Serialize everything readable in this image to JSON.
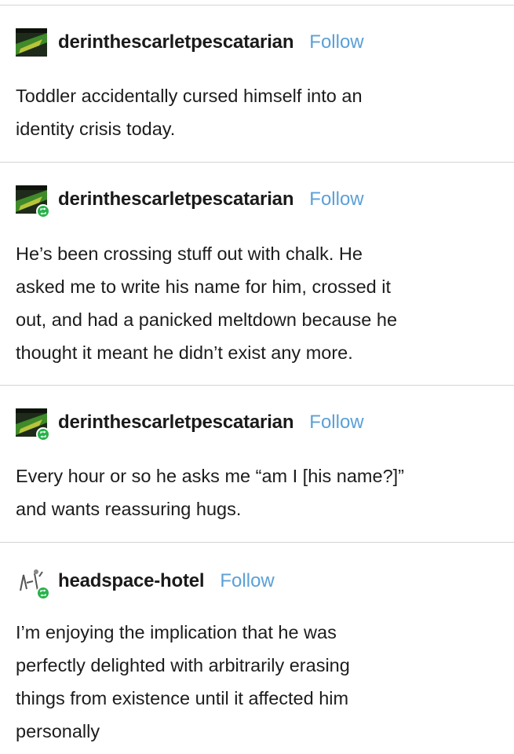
{
  "posts": [
    {
      "username": "derinthescarletpescatarian",
      "follow_label": "Follow",
      "avatar_icon": "green-abstract-avatar-icon",
      "lines": [
        "Toddler accidentally cursed himself into an",
        "identity crisis today."
      ]
    },
    {
      "username": "derinthescarletpescatarian",
      "follow_label": "Follow",
      "avatar_icon": "green-abstract-avatar-icon",
      "badge_icon": "reblog-badge-icon",
      "lines": [
        "He’s been crossing stuff out with chalk. He",
        "asked me to write his name for him, crossed it",
        "out, and had a panicked meltdown because he",
        "thought it meant he didn’t exist any more."
      ]
    },
    {
      "username": "derinthescarletpescatarian",
      "follow_label": "Follow",
      "avatar_icon": "green-abstract-avatar-icon",
      "badge_icon": "reblog-badge-icon",
      "lines": [
        "Every hour or so he asks me “am I [his name?]”",
        "and wants reassuring hugs."
      ]
    },
    {
      "username": "headspace-hotel",
      "follow_label": "Follow",
      "avatar_icon": "sketch-avatar-icon",
      "badge_icon": "reblog-badge-icon",
      "lines": [
        "I’m enjoying the implication that he was",
        "perfectly delighted with arbitrarily erasing",
        "things from existence until it affected him",
        "personally"
      ]
    }
  ],
  "colors": {
    "follow": "#5aa0d8",
    "badge": "#27b24a",
    "divider": "#d4d4d4",
    "text": "#1c1c1c"
  }
}
